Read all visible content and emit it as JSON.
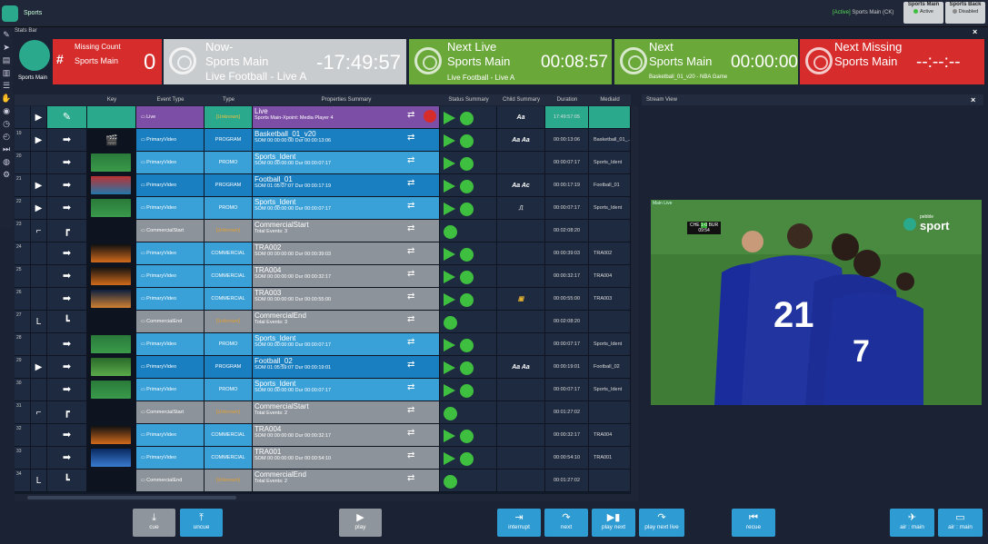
{
  "app": {
    "title": "Sports",
    "active_prefix": "[Active]",
    "active_channel": "Sports Main (CK)"
  },
  "channels": [
    {
      "name": "Sports Main",
      "status": "Active",
      "color": "#3fbf3f"
    },
    {
      "name": "Sports Back",
      "status": "Disabled",
      "color": "#8a8a8a"
    }
  ],
  "stats_bar": {
    "title": "Stats Bar",
    "close": "×",
    "logo_label": "Sports Main",
    "missing": {
      "label": "Missing Count",
      "channel": "Sports Main",
      "value": "0"
    },
    "now": {
      "label": "Now-",
      "channel": "Sports Main",
      "event": "Live Football - Live A",
      "time": "-17:49:57"
    },
    "next_live": {
      "label": "Next Live",
      "channel": "Sports Main",
      "event": "Live Football - Live A",
      "time": "00:08:57"
    },
    "next": {
      "label": "Next",
      "channel": "Sports Main",
      "event": "Basketball_01_v20 - NBA Game",
      "time": "00:00:00"
    },
    "next_missing": {
      "label": "Next Missing",
      "channel": "Sports Main",
      "time": "--:--:--"
    }
  },
  "columns": [
    "Key",
    "Event Type",
    "Type",
    "Properties Summary",
    "Status Summary",
    "Child Summary",
    "Duration",
    "MediaId"
  ],
  "stream_view": {
    "title": "Stream View",
    "close": "×",
    "overlay": {
      "teams_left": "CHE",
      "score": "1-0",
      "teams_right": "BUR",
      "clock": "09:54",
      "channel_top": "pebble",
      "channel_bottom": "sport",
      "corner": "Main Live"
    }
  },
  "rows": [
    {
      "num": "",
      "key": "live",
      "event": "Live",
      "type": "[Unknown]",
      "title": "Live",
      "sub": "Sports Main-Xpoint: Media Player 4",
      "child": "Aa",
      "duration": "17:49:57:05",
      "media": "",
      "theme": "live"
    },
    {
      "num": "19",
      "key": "clap",
      "event": "PrimaryVideo",
      "type": "PROGRAM",
      "title": "Basketball_01_v20",
      "sub": "SOM 00:00:00:00 Dur 00:00:13:06",
      "child": "Aa Aa",
      "duration": "00:00:13:06",
      "media": "Basketball_01_...",
      "theme": "prog"
    },
    {
      "num": "20",
      "key": "pitch",
      "event": "PrimaryVideo",
      "type": "PROMO",
      "title": "Sports_Ident",
      "sub": "SOM 00:00:00:00 Dur 00:00:07:17",
      "child": "",
      "duration": "00:00:07:17",
      "media": "Sports_Ident",
      "theme": "promo"
    },
    {
      "num": "21",
      "key": "crowd",
      "event": "PrimaryVideo",
      "type": "PROGRAM",
      "title": "Football_01",
      "sub": "SOM 01:05:07:07 Dur 00:00:17:19",
      "child": "Aa Ac",
      "duration": "00:00:17:19",
      "media": "Football_01",
      "theme": "prog"
    },
    {
      "num": "22",
      "key": "pitch",
      "event": "PrimaryVideo",
      "type": "PROMO",
      "title": "Sports_Ident",
      "sub": "SOM 00:00:00:00 Dur 00:00:07:17",
      "child": "⎍",
      "duration": "00:00:07:17",
      "media": "Sports_Ident",
      "theme": "promo"
    },
    {
      "num": "23",
      "key": "none",
      "event": "CommercialStart",
      "type": "[Unknown]",
      "title": "CommercialStart",
      "sub": "Total Events: 3",
      "child": "",
      "duration": "00:02:08:20",
      "media": "",
      "theme": "comstart"
    },
    {
      "num": "24",
      "key": "sunset",
      "event": "PrimaryVideo",
      "type": "COMMERCIAL",
      "title": "TRA002",
      "sub": "SOM 00:00:00:00 Dur 00:00:39:03",
      "child": "",
      "duration": "00:00:39:03",
      "media": "TRA002",
      "theme": "com"
    },
    {
      "num": "25",
      "key": "sunset",
      "event": "PrimaryVideo",
      "type": "COMMERCIAL",
      "title": "TRA004",
      "sub": "SOM 00:00:00:00 Dur 00:00:32:17",
      "child": "",
      "duration": "00:00:32:17",
      "media": "TRA004",
      "theme": "com"
    },
    {
      "num": "26",
      "key": "city",
      "event": "PrimaryVideo",
      "type": "COMMERCIAL",
      "title": "TRA003",
      "sub": "SOM 00:00:00:00 Dur 00:00:55:00",
      "child": "▣",
      "duration": "00:00:55:00",
      "media": "TRA003",
      "theme": "com"
    },
    {
      "num": "27",
      "key": "none",
      "event": "CommercialEnd",
      "type": "[Unknown]",
      "title": "CommercialEnd",
      "sub": "Total Events: 3",
      "child": "",
      "duration": "00:02:08:20",
      "media": "",
      "theme": "comend"
    },
    {
      "num": "28",
      "key": "pitch",
      "event": "PrimaryVideo",
      "type": "PROMO",
      "title": "Sports_Ident",
      "sub": "SOM 00:00:00:00 Dur 00:00:07:17",
      "child": "",
      "duration": "00:00:07:17",
      "media": "Sports_Ident",
      "theme": "promo"
    },
    {
      "num": "29",
      "key": "field",
      "event": "PrimaryVideo",
      "type": "PROGRAM",
      "title": "Football_02",
      "sub": "SOM 01:05:59:07 Dur 00:00:19:01",
      "child": "Aa Aa",
      "duration": "00:00:19:01",
      "media": "Football_02",
      "theme": "prog"
    },
    {
      "num": "30",
      "key": "pitch",
      "event": "PrimaryVideo",
      "type": "PROMO",
      "title": "Sports_Ident",
      "sub": "SOM 00:00:00:00 Dur 00:00:07:17",
      "child": "",
      "duration": "00:00:07:17",
      "media": "Sports_Ident",
      "theme": "promo"
    },
    {
      "num": "31",
      "key": "none",
      "event": "CommercialStart",
      "type": "[Unknown]",
      "title": "CommercialStart",
      "sub": "Total Events: 2",
      "child": "",
      "duration": "00:01:27:02",
      "media": "",
      "theme": "comstart"
    },
    {
      "num": "32",
      "key": "sunset",
      "event": "PrimaryVideo",
      "type": "COMMERCIAL",
      "title": "TRA004",
      "sub": "SOM 00:00:00:00 Dur 00:00:32:17",
      "child": "",
      "duration": "00:00:32:17",
      "media": "TRA004",
      "theme": "com"
    },
    {
      "num": "33",
      "key": "blue",
      "event": "PrimaryVideo",
      "type": "COMMERCIAL",
      "title": "TRA001",
      "sub": "SOM 00:00:00:00 Dur 00:00:54:10",
      "child": "",
      "duration": "00:00:54:10",
      "media": "TRA001",
      "theme": "com"
    },
    {
      "num": "34",
      "key": "none",
      "event": "CommercialEnd",
      "type": "[Unknown]",
      "title": "CommercialEnd",
      "sub": "Total Events: 2",
      "child": "",
      "duration": "00:01:27:02",
      "media": "",
      "theme": "comend"
    }
  ],
  "buttons": [
    {
      "label": "cue",
      "icon": "⤓",
      "style": "gr"
    },
    {
      "label": "uncue",
      "icon": "⤒",
      "style": "bl"
    },
    {
      "label": "play",
      "icon": "▶",
      "style": "gr"
    },
    {
      "label": "interrupt",
      "icon": "⇥",
      "style": "bl"
    },
    {
      "label": "next",
      "icon": "↷",
      "style": "bl"
    },
    {
      "label": "play next",
      "icon": "▶▮",
      "style": "bl"
    },
    {
      "label": "play next live",
      "icon": "↷",
      "style": "bl"
    },
    {
      "label": "recue",
      "icon": "⏮",
      "style": "bl"
    },
    {
      "label": "air : main",
      "icon": "✈",
      "style": "bl"
    },
    {
      "label": "air : main",
      "icon": "▭",
      "style": "bl"
    }
  ],
  "colors": {
    "live": "#7d4ea6",
    "prog": "#1a7fc0",
    "promo": "#3aa0d8",
    "com": "#3aa0d8",
    "grey": "#8d939a",
    "teal": "#2aa98c",
    "red": "#d62c2c",
    "green": "#6aa83a"
  }
}
